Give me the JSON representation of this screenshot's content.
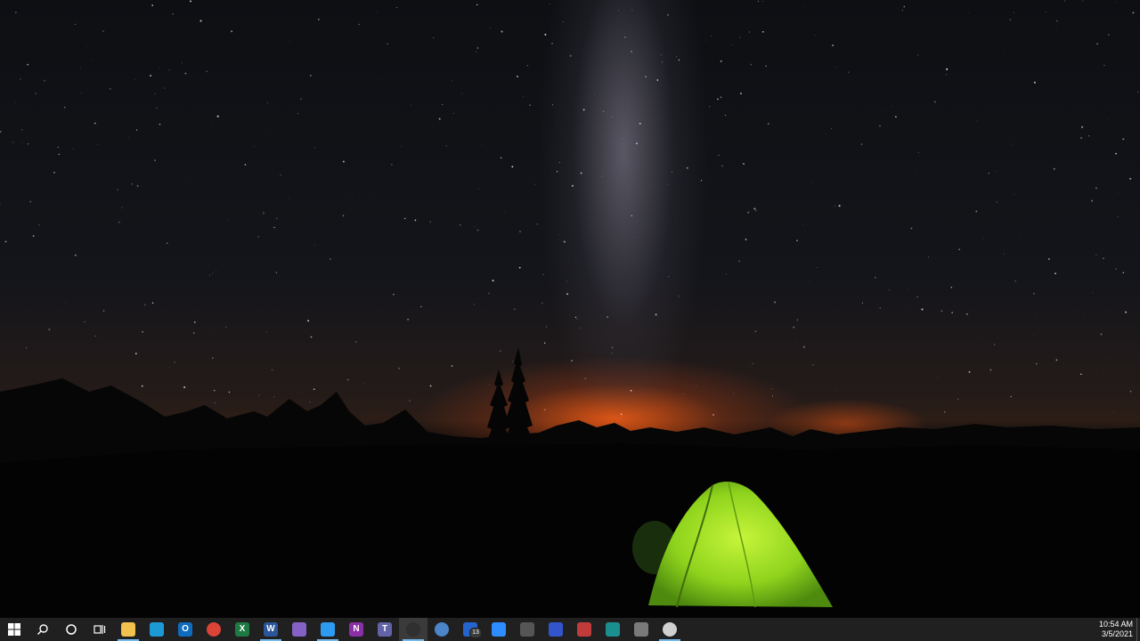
{
  "taskbar": {
    "start_label": "Start",
    "search_label": "Search",
    "cortana_label": "Cortana",
    "task_view_label": "Task View",
    "apps": [
      {
        "name": "file-explorer",
        "glyph": "",
        "color": "#f2c14e",
        "active": true
      },
      {
        "name": "browser-compass",
        "glyph": "",
        "color": "#1c9ad6",
        "active": false
      },
      {
        "name": "outlook",
        "glyph": "O",
        "color": "#0f6cbd",
        "active": false
      },
      {
        "name": "chrome",
        "glyph": "",
        "color": "#db4437",
        "active": false
      },
      {
        "name": "excel",
        "glyph": "X",
        "color": "#1d7a43",
        "active": false
      },
      {
        "name": "word",
        "glyph": "W",
        "color": "#2b579a",
        "active": true
      },
      {
        "name": "visual-studio",
        "glyph": "",
        "color": "#8661c5",
        "active": false
      },
      {
        "name": "vs-code",
        "glyph": "",
        "color": "#2d9bf0",
        "active": true
      },
      {
        "name": "onenote",
        "glyph": "N",
        "color": "#8a2fa6",
        "active": false
      },
      {
        "name": "teams",
        "glyph": "T",
        "color": "#6264a7",
        "active": false
      },
      {
        "name": "obs-studio",
        "glyph": "",
        "color": "#2f2f2f",
        "active": true
      },
      {
        "name": "globe-app",
        "glyph": "",
        "color": "#4a86c9",
        "active": false
      },
      {
        "name": "todo",
        "glyph": "",
        "color": "#2564cf",
        "active": false,
        "badge": "13"
      },
      {
        "name": "zoom",
        "glyph": "",
        "color": "#2d8cff",
        "active": false
      },
      {
        "name": "snipping-tool",
        "glyph": "",
        "color": "#555555",
        "active": false
      },
      {
        "name": "firefox-dev",
        "glyph": "",
        "color": "#3355cc",
        "active": false
      },
      {
        "name": "color-picker",
        "glyph": "",
        "color": "#c23b3b",
        "active": false
      },
      {
        "name": "panel-app",
        "glyph": "",
        "color": "#1b8f8f",
        "active": false
      },
      {
        "name": "printer-app",
        "glyph": "",
        "color": "#7a7a7a",
        "active": false
      },
      {
        "name": "recorder",
        "glyph": "",
        "color": "#d0d0d0",
        "active": true
      }
    ],
    "clock": {
      "time": "10:54 AM",
      "date": "3/5/2021"
    }
  }
}
